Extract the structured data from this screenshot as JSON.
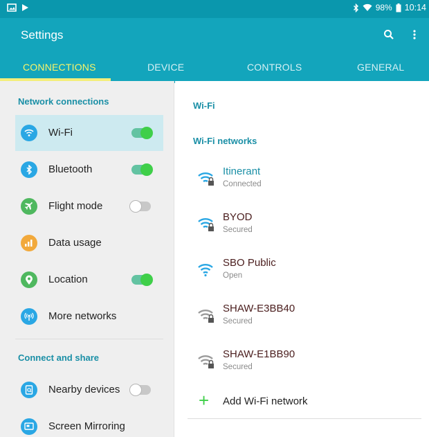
{
  "status_bar": {
    "bluetooth_icon": "bluetooth-icon",
    "wifi_icon": "wifi-icon",
    "battery_percent": "98%",
    "time": "10:14"
  },
  "app_bar": {
    "title": "Settings",
    "search_icon": "search-icon",
    "more_icon": "more-vert-icon"
  },
  "tabs": [
    {
      "label": "CONNECTIONS",
      "active": true
    },
    {
      "label": "DEVICE",
      "active": false
    },
    {
      "label": "CONTROLS",
      "active": false
    },
    {
      "label": "GENERAL",
      "active": false
    }
  ],
  "left_panel": {
    "section1": "Network connections",
    "items1": [
      {
        "label": "Wi-Fi",
        "icon": "wifi-icon",
        "color": "#2aa7e4",
        "toggle": "on",
        "selected": true
      },
      {
        "label": "Bluetooth",
        "icon": "bluetooth-icon",
        "color": "#2aa7e4",
        "toggle": "on"
      },
      {
        "label": "Flight mode",
        "icon": "airplane-icon",
        "color": "#4fb85f",
        "toggle": "off"
      },
      {
        "label": "Data usage",
        "icon": "data-usage-icon",
        "color": "#f2a93b",
        "toggle": null
      },
      {
        "label": "Location",
        "icon": "location-icon",
        "color": "#4fb85f",
        "toggle": "on"
      },
      {
        "label": "More networks",
        "icon": "more-networks-icon",
        "color": "#2aa7e4",
        "toggle": null
      }
    ],
    "section2": "Connect and share",
    "items2": [
      {
        "label": "Nearby devices",
        "icon": "nearby-devices-icon",
        "color": "#2aa7e4",
        "toggle": "off"
      },
      {
        "label": "Screen Mirroring",
        "icon": "screen-mirroring-icon",
        "color": "#2aa7e4",
        "toggle": null
      }
    ]
  },
  "right_panel": {
    "wifi_header": "Wi-Fi",
    "networks_header": "Wi-Fi networks",
    "networks": [
      {
        "name": "Itinerant",
        "status": "Connected",
        "name_color": "#1a8fa6",
        "icon_color": "#2aa7e4",
        "locked": true
      },
      {
        "name": "BYOD",
        "status": "Secured",
        "name_color": "#4a1d1d",
        "icon_color": "#2aa7e4",
        "locked": true
      },
      {
        "name": "SBO Public",
        "status": "Open",
        "name_color": "#4a1d1d",
        "icon_color": "#2aa7e4",
        "locked": false
      },
      {
        "name": "SHAW-E3BB40",
        "status": "Secured",
        "name_color": "#4a1d1d",
        "icon_color": "#9b9b9b",
        "locked": true
      },
      {
        "name": "SHAW-E1BB90",
        "status": "Secured",
        "name_color": "#4a1d1d",
        "icon_color": "#9b9b9b",
        "locked": true
      }
    ],
    "add_label": "Add Wi-Fi network"
  }
}
